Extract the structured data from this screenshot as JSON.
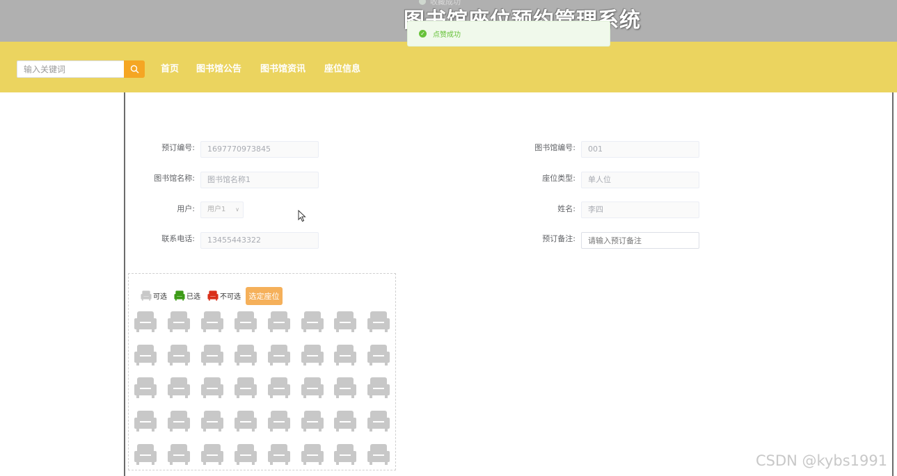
{
  "header": {
    "site_title": "图书馆座位预约管理系统",
    "ghost_toast": "收藏成功"
  },
  "toast": {
    "message": "点赞成功",
    "color": "#67c23a"
  },
  "search": {
    "placeholder": "输入关键词",
    "value": "",
    "icon": "search-icon"
  },
  "nav": {
    "items": [
      {
        "label": "首页"
      },
      {
        "label": "图书馆公告"
      },
      {
        "label": "图书馆资讯"
      },
      {
        "label": "座位信息"
      }
    ]
  },
  "form": {
    "booking_no_label": "预订编号:",
    "booking_no_value": "1697770973845",
    "library_no_label": "图书馆编号:",
    "library_no_value": "001",
    "library_name_label": "图书馆名称:",
    "library_name_value": "图书馆名称1",
    "seat_type_label": "座位类型:",
    "seat_type_value": "单人位",
    "user_label": "用户:",
    "user_value": "用户1",
    "name_label": "姓名:",
    "name_value": "李四",
    "phone_label": "联系电话:",
    "phone_value": "13455443322",
    "remark_label": "预订备注:",
    "remark_placeholder": "请输入预订备注",
    "remark_value": ""
  },
  "seat_map": {
    "legend": [
      {
        "label": "可选",
        "color": "#c8c8c8"
      },
      {
        "label": "已选",
        "color": "#3c9a16"
      },
      {
        "label": "不可选",
        "color": "#d9301a"
      }
    ],
    "select_button_label": "选定座位",
    "rows": 5,
    "columns": 8,
    "seat_icon": "armchair-icon",
    "seat_status": [
      [
        "可选",
        "可选",
        "可选",
        "可选",
        "可选",
        "可选",
        "可选",
        "可选"
      ],
      [
        "可选",
        "可选",
        "可选",
        "可选",
        "可选",
        "可选",
        "可选",
        "可选"
      ],
      [
        "可选",
        "可选",
        "可选",
        "可选",
        "可选",
        "可选",
        "可选",
        "可选"
      ],
      [
        "可选",
        "可选",
        "可选",
        "可选",
        "可选",
        "可选",
        "可选",
        "可选"
      ],
      [
        "可选",
        "可选",
        "可选",
        "可选",
        "可选",
        "可选",
        "可选",
        "可选"
      ]
    ]
  },
  "watermark": "CSDN @kybs1991",
  "colors": {
    "nav_bg": "#ebd45f",
    "top_band": "#b0b0b0",
    "search_button": "#f5a623",
    "select_button": "#f5b05a"
  }
}
